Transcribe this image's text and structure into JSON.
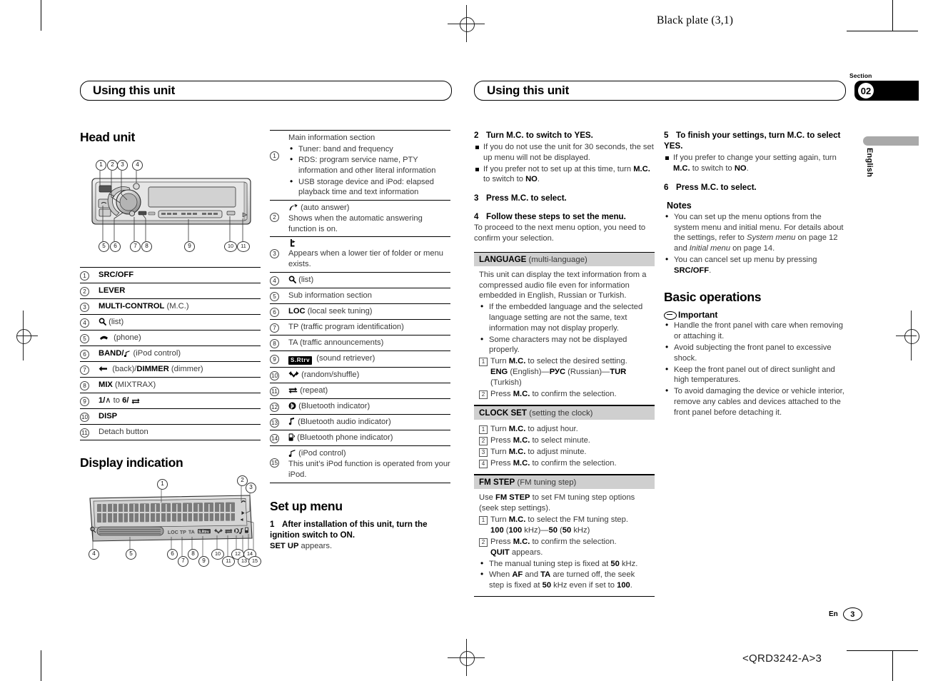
{
  "print_marks": {
    "black_plate": "Black plate (3,1)",
    "colophon": "<QRD3242-A>3"
  },
  "section_tab": {
    "label": "Section",
    "number": "02",
    "language": "English"
  },
  "chapter_titles": {
    "left": "Using this unit",
    "right": "Using this unit"
  },
  "footer": {
    "lang_code": "En",
    "page_number": "3"
  },
  "head_unit": {
    "title": "Head unit",
    "callouts_top": [
      "1",
      "2",
      "3",
      "4"
    ],
    "callouts_bottom": [
      "5",
      "6",
      "7",
      "8",
      "9",
      "10",
      "11"
    ],
    "items": [
      {
        "n": "1",
        "label": "SRC/OFF",
        "note": ""
      },
      {
        "n": "2",
        "label": "LEVER",
        "note": ""
      },
      {
        "n": "3",
        "label": "MULTI-CONTROL",
        "note": "(M.C.)"
      },
      {
        "n": "4",
        "label": "⌕",
        "note": "(list)"
      },
      {
        "n": "5",
        "label": "⌕",
        "note": "(phone)"
      },
      {
        "n": "6",
        "label": "BAND/",
        "note": "(iPod control)"
      },
      {
        "n": "7",
        "label": "(back)/DIMMER",
        "note": "(dimmer)"
      },
      {
        "n": "8",
        "label": "MIX",
        "note": "(MIXTRAX)"
      },
      {
        "n": "9",
        "label": "1/∧ to 6/",
        "note": ""
      },
      {
        "n": "10",
        "label": "DISP",
        "note": ""
      },
      {
        "n": "11",
        "label": "Detach button",
        "note": "",
        "plain": true
      }
    ]
  },
  "display_indication": {
    "title": "Display indication",
    "callouts": [
      "1",
      "2",
      "3",
      "4",
      "5",
      "6",
      "7",
      "8",
      "9",
      "10",
      "11",
      "12",
      "13",
      "14",
      "15"
    ],
    "segment_labels": [
      "LOC",
      "TP",
      "TA",
      "S.Rtrv"
    ],
    "items": [
      {
        "n": "1",
        "head": "Main information section",
        "bullets": [
          "Tuner: band and frequency",
          "RDS: program service name, PTY information and other literal information",
          "USB storage device and iPod: elapsed playback time and text information"
        ]
      },
      {
        "n": "2",
        "head": "(auto answer)",
        "text": "Shows when the automatic answering function is on."
      },
      {
        "n": "3",
        "head": "",
        "text": "Appears when a lower tier of folder or menu exists."
      },
      {
        "n": "4",
        "head": "(list)",
        "text": ""
      },
      {
        "n": "5",
        "head": "Sub information section",
        "text": ""
      },
      {
        "n": "6",
        "head": "LOC",
        "note": "(local seek tuning)"
      },
      {
        "n": "7",
        "head": "TP",
        "note": "(traffic program identification)"
      },
      {
        "n": "8",
        "head": "TA",
        "note": "(traffic announcements)"
      },
      {
        "n": "9",
        "head": "S.Rtrv",
        "note": "(sound retriever)"
      },
      {
        "n": "10",
        "head": "",
        "note": "(random/shuffle)"
      },
      {
        "n": "11",
        "head": "",
        "note": "(repeat)"
      },
      {
        "n": "12",
        "head": "",
        "note": "(Bluetooth indicator)"
      },
      {
        "n": "13",
        "head": "",
        "note": "(Bluetooth audio indicator)"
      },
      {
        "n": "14",
        "head": "",
        "note": "(Bluetooth phone indicator)"
      },
      {
        "n": "15",
        "head": "(iPod control)",
        "text": "This unit’s iPod function is operated from your iPod."
      }
    ]
  },
  "set_up_menu": {
    "title": "Set up menu",
    "step1_num": "1",
    "step1": "After installation of this unit, turn the ignition switch to ON.",
    "step1_note_bold": "SET UP",
    "step1_note_rest": " appears.",
    "step2_num": "2",
    "step2": "Turn M.C. to switch to YES.",
    "step2_notes": [
      "If you do not use the unit for 30 seconds, the set up menu will not be displayed.",
      "If you prefer not to set up at this time, turn M.C. to switch to NO."
    ],
    "step3_num": "3",
    "step3": "Press M.C. to select.",
    "step4_num": "4",
    "step4": "Follow these steps to set the menu.",
    "step4_note": "To proceed to the next menu option, you need to confirm your selection.",
    "step5_num": "5",
    "step5": "To finish your settings, turn M.C. to select YES.",
    "step5_note": "If you prefer to change your setting again, turn M.C. to switch to NO.",
    "step6_num": "6",
    "step6": "Press M.C. to select.",
    "notes_title": "Notes",
    "notes": [
      "You can set up the menu options from the system menu and initial menu. For details about the settings, refer to System menu on page 12 and Initial menu on page 14.",
      "You can cancel set up menu by pressing SRC/OFF."
    ],
    "settings": [
      {
        "name": "LANGUAGE",
        "subtitle": "(multi-language)",
        "intro": "This unit can display the text information from a compressed audio file even for information embedded in English, Russian or Turkish.",
        "bullets": [
          "If the embedded language and the selected language setting are not the same, text information may not display properly.",
          "Some characters may not be displayed properly."
        ],
        "steps": [
          "Turn M.C. to select the desired setting.",
          "Press M.C. to confirm the selection."
        ],
        "options_line": "ENG (English)—РУС (Russian)—TUR (Turkish)"
      },
      {
        "name": "CLOCK SET",
        "subtitle": "(setting the clock)",
        "steps": [
          "Turn M.C. to adjust hour.",
          "Press M.C. to select minute.",
          "Turn M.C. to adjust minute.",
          "Press M.C. to confirm the selection."
        ]
      },
      {
        "name": "FM STEP",
        "subtitle": "(FM tuning step)",
        "intro": "Use FM STEP to set FM tuning step options (seek step settings).",
        "steps": [
          "Turn M.C. to select the FM tuning step.",
          "Press M.C. to confirm the selection."
        ],
        "options_line": "100 (100 kHz)—50 (50 kHz)",
        "quit_line": "QUIT appears.",
        "bullets": [
          "The manual tuning step is fixed at 50 kHz.",
          "When AF and TA are turned off, the seek step is fixed at 50 kHz even if set to 100."
        ]
      }
    ]
  },
  "basic_operations": {
    "title": "Basic operations",
    "important_title": "Important",
    "important": [
      "Handle the front panel with care when removing or attaching it.",
      "Avoid subjecting the front panel to excessive shock.",
      "Keep the front panel out of direct sunlight and high temperatures.",
      "To avoid damaging the device or vehicle interior, remove any cables and devices attached to the front panel before detaching it."
    ]
  },
  "colors": {
    "setting_bar": "#cfcfcf",
    "section_badge": "#000000",
    "lang_tab": "#a9a9a9"
  }
}
